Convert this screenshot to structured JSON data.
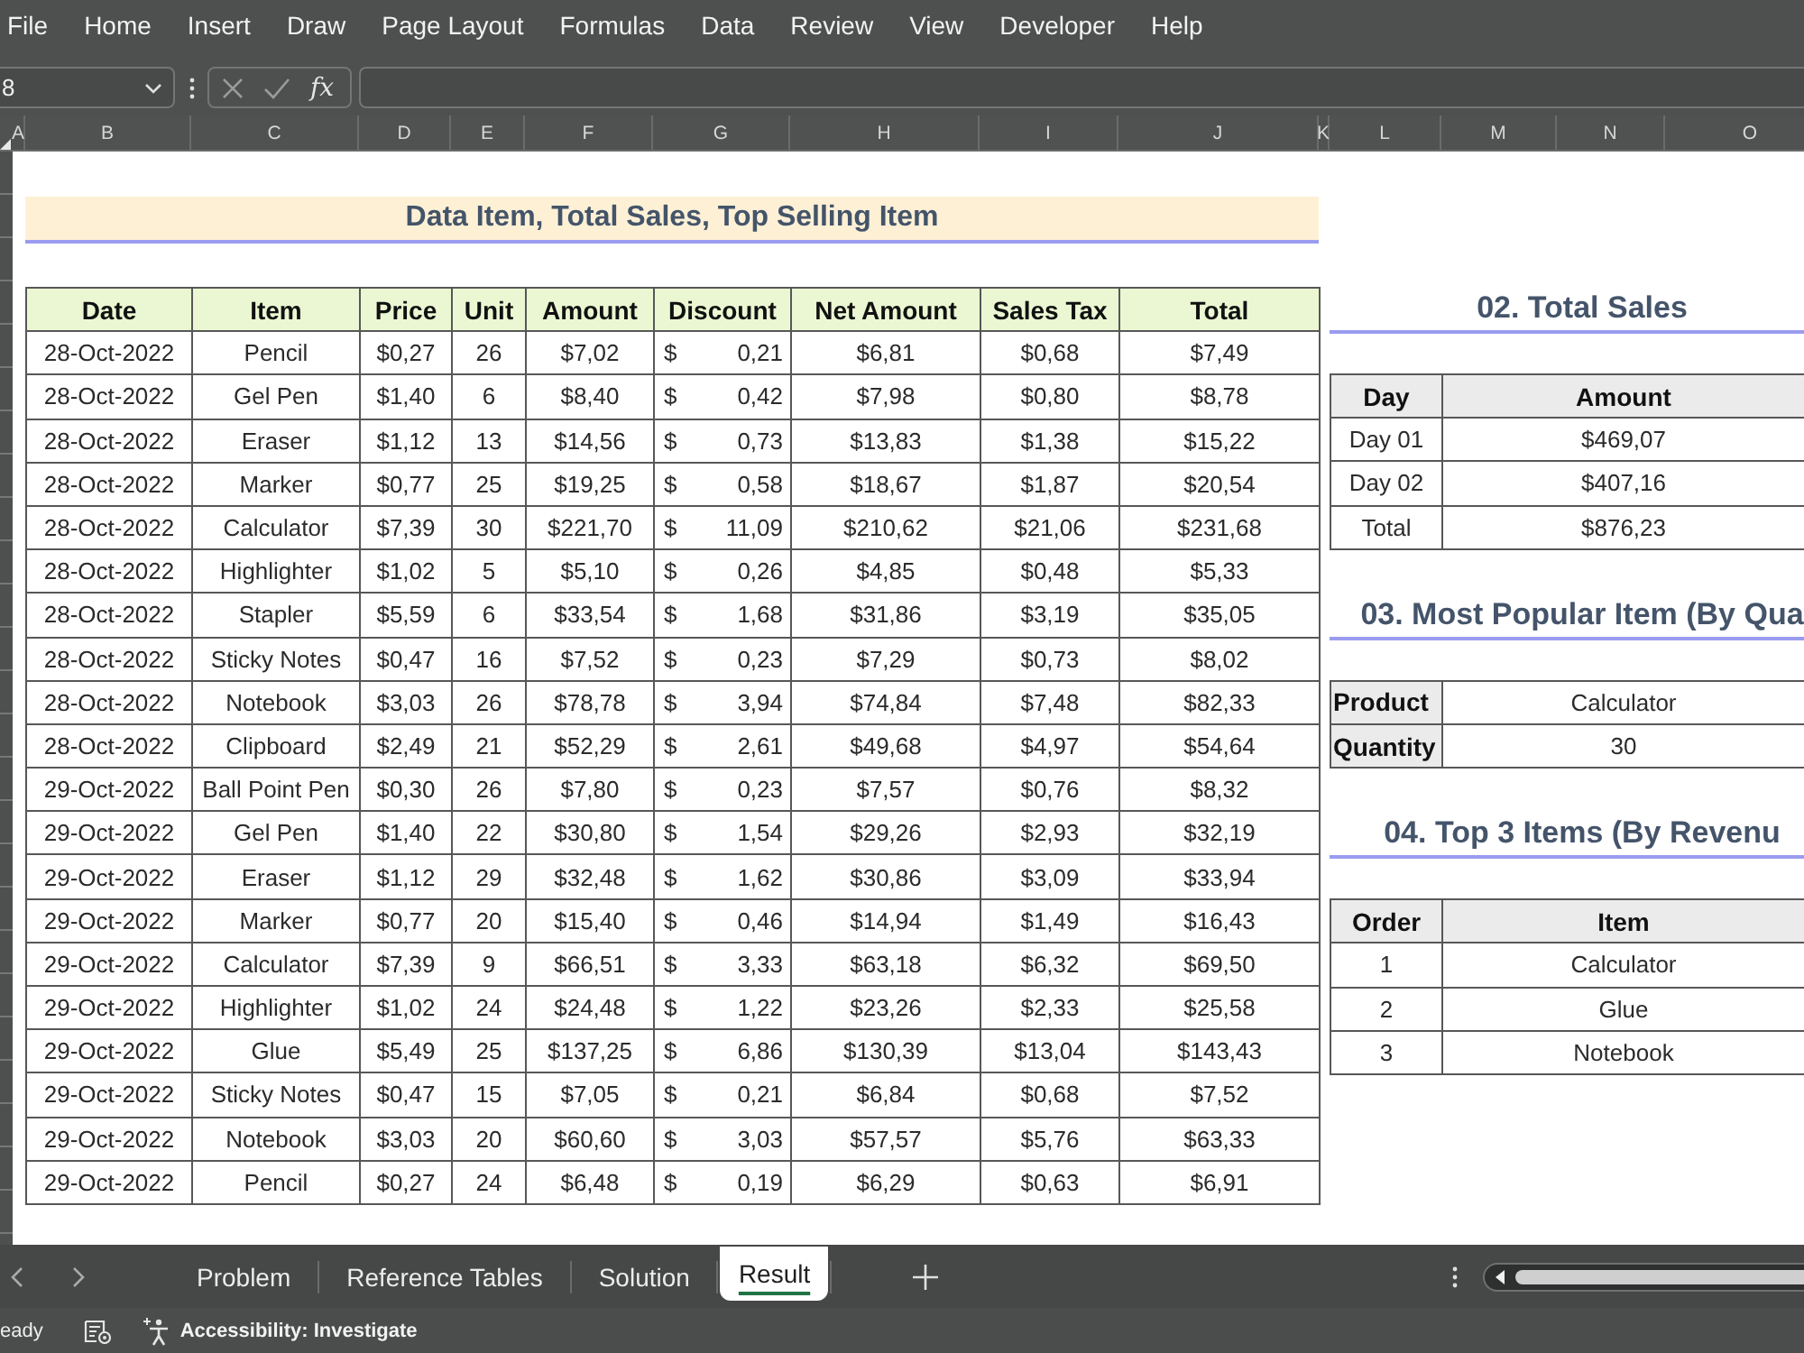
{
  "menu_bar": {
    "items": [
      "File",
      "Home",
      "Insert",
      "Draw",
      "Page Layout",
      "Formulas",
      "Data",
      "Review",
      "View",
      "Developer",
      "Help"
    ]
  },
  "formula_bar": {
    "name_box": "8",
    "function_label": "fx"
  },
  "column_headers": [
    "A",
    "B",
    "C",
    "D",
    "E",
    "F",
    "G",
    "H",
    "I",
    "J",
    "K",
    "L",
    "M",
    "N",
    "O"
  ],
  "sheet": {
    "title": "Data Item, Total Sales, Top Selling Item",
    "data_table": {
      "columns": [
        {
          "label": "Date",
          "kind": "text"
        },
        {
          "label": "Item",
          "kind": "text"
        },
        {
          "label": "Price",
          "kind": "text"
        },
        {
          "label": "Unit",
          "kind": "text"
        },
        {
          "label": "Amount",
          "kind": "text"
        },
        {
          "label": "Discount",
          "kind": "accounting"
        },
        {
          "label": "Net Amount",
          "kind": "text"
        },
        {
          "label": "Sales Tax",
          "kind": "text"
        },
        {
          "label": "Total",
          "kind": "text"
        }
      ],
      "rows": [
        [
          "28-Oct-2022",
          "Pencil",
          "$0,27",
          "26",
          "$7,02",
          {
            "currency": "$",
            "value": "0,21"
          },
          "$6,81",
          "$0,68",
          "$7,49"
        ],
        [
          "28-Oct-2022",
          "Gel Pen",
          "$1,40",
          "6",
          "$8,40",
          {
            "currency": "$",
            "value": "0,42"
          },
          "$7,98",
          "$0,80",
          "$8,78"
        ],
        [
          "28-Oct-2022",
          "Eraser",
          "$1,12",
          "13",
          "$14,56",
          {
            "currency": "$",
            "value": "0,73"
          },
          "$13,83",
          "$1,38",
          "$15,22"
        ],
        [
          "28-Oct-2022",
          "Marker",
          "$0,77",
          "25",
          "$19,25",
          {
            "currency": "$",
            "value": "0,58"
          },
          "$18,67",
          "$1,87",
          "$20,54"
        ],
        [
          "28-Oct-2022",
          "Calculator",
          "$7,39",
          "30",
          "$221,70",
          {
            "currency": "$",
            "value": "11,09"
          },
          "$210,62",
          "$21,06",
          "$231,68"
        ],
        [
          "28-Oct-2022",
          "Highlighter",
          "$1,02",
          "5",
          "$5,10",
          {
            "currency": "$",
            "value": "0,26"
          },
          "$4,85",
          "$0,48",
          "$5,33"
        ],
        [
          "28-Oct-2022",
          "Stapler",
          "$5,59",
          "6",
          "$33,54",
          {
            "currency": "$",
            "value": "1,68"
          },
          "$31,86",
          "$3,19",
          "$35,05"
        ],
        [
          "28-Oct-2022",
          "Sticky Notes",
          "$0,47",
          "16",
          "$7,52",
          {
            "currency": "$",
            "value": "0,23"
          },
          "$7,29",
          "$0,73",
          "$8,02"
        ],
        [
          "28-Oct-2022",
          "Notebook",
          "$3,03",
          "26",
          "$78,78",
          {
            "currency": "$",
            "value": "3,94"
          },
          "$74,84",
          "$7,48",
          "$82,33"
        ],
        [
          "28-Oct-2022",
          "Clipboard",
          "$2,49",
          "21",
          "$52,29",
          {
            "currency": "$",
            "value": "2,61"
          },
          "$49,68",
          "$4,97",
          "$54,64"
        ],
        [
          "29-Oct-2022",
          "Ball Point Pen",
          "$0,30",
          "26",
          "$7,80",
          {
            "currency": "$",
            "value": "0,23"
          },
          "$7,57",
          "$0,76",
          "$8,32"
        ],
        [
          "29-Oct-2022",
          "Gel Pen",
          "$1,40",
          "22",
          "$30,80",
          {
            "currency": "$",
            "value": "1,54"
          },
          "$29,26",
          "$2,93",
          "$32,19"
        ],
        [
          "29-Oct-2022",
          "Eraser",
          "$1,12",
          "29",
          "$32,48",
          {
            "currency": "$",
            "value": "1,62"
          },
          "$30,86",
          "$3,09",
          "$33,94"
        ],
        [
          "29-Oct-2022",
          "Marker",
          "$0,77",
          "20",
          "$15,40",
          {
            "currency": "$",
            "value": "0,46"
          },
          "$14,94",
          "$1,49",
          "$16,43"
        ],
        [
          "29-Oct-2022",
          "Calculator",
          "$7,39",
          "9",
          "$66,51",
          {
            "currency": "$",
            "value": "3,33"
          },
          "$63,18",
          "$6,32",
          "$69,50"
        ],
        [
          "29-Oct-2022",
          "Highlighter",
          "$1,02",
          "24",
          "$24,48",
          {
            "currency": "$",
            "value": "1,22"
          },
          "$23,26",
          "$2,33",
          "$25,58"
        ],
        [
          "29-Oct-2022",
          "Glue",
          "$5,49",
          "25",
          "$137,25",
          {
            "currency": "$",
            "value": "6,86"
          },
          "$130,39",
          "$13,04",
          "$143,43"
        ],
        [
          "29-Oct-2022",
          "Sticky Notes",
          "$0,47",
          "15",
          "$7,05",
          {
            "currency": "$",
            "value": "0,21"
          },
          "$6,84",
          "$0,68",
          "$7,52"
        ],
        [
          "29-Oct-2022",
          "Notebook",
          "$3,03",
          "20",
          "$60,60",
          {
            "currency": "$",
            "value": "3,03"
          },
          "$57,57",
          "$5,76",
          "$63,33"
        ],
        [
          "29-Oct-2022",
          "Pencil",
          "$0,27",
          "24",
          "$6,48",
          {
            "currency": "$",
            "value": "0,19"
          },
          "$6,29",
          "$0,63",
          "$6,91"
        ]
      ]
    },
    "summary": [
      {
        "kind": "table",
        "title": "02. Total Sales",
        "columns": [
          "Day",
          "Amount"
        ],
        "rows": [
          [
            "Day 01",
            "$469,07"
          ],
          [
            "Day 02",
            "$407,16"
          ],
          [
            "Total",
            "$876,23"
          ]
        ]
      },
      {
        "kind": "key_value",
        "title": "03. Most Popular Item (By Qua",
        "rows": [
          {
            "label": "Product",
            "value": "Calculator"
          },
          {
            "label": "Quantity",
            "value": "30"
          }
        ]
      },
      {
        "kind": "table",
        "title": "04. Top 3 Items (By Revenu",
        "columns": [
          "Order",
          "Item"
        ],
        "rows": [
          [
            "1",
            "Calculator"
          ],
          [
            "2",
            "Glue"
          ],
          [
            "3",
            "Notebook"
          ]
        ]
      }
    ]
  },
  "sheet_tabs": [
    {
      "label": "Problem",
      "selected": false
    },
    {
      "label": "Reference Tables",
      "selected": false
    },
    {
      "label": "Solution",
      "selected": false
    },
    {
      "label": "Result",
      "selected": true
    }
  ],
  "status_bar": {
    "mode": "eady",
    "accessibility": "Accessibility: Investigate"
  }
}
